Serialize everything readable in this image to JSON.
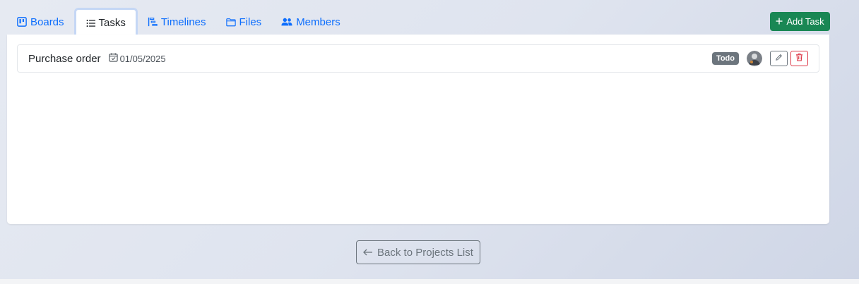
{
  "tabs": [
    {
      "label": "Boards",
      "icon": "kanban-icon"
    },
    {
      "label": "Tasks",
      "icon": "list-icon",
      "active": true
    },
    {
      "label": "Timelines",
      "icon": "timeline-icon"
    },
    {
      "label": "Files",
      "icon": "folder-icon"
    },
    {
      "label": "Members",
      "icon": "people-icon"
    }
  ],
  "toolbar": {
    "add_task_label": "Add Task"
  },
  "tasks": [
    {
      "title": "Purchase order",
      "date": "01/05/2025",
      "status": "Todo"
    }
  ],
  "footer": {
    "back_label": "Back to Projects List"
  },
  "colors": {
    "link": "#0d6efd",
    "success": "#198754",
    "secondary": "#6c757d",
    "danger": "#dc3545"
  }
}
